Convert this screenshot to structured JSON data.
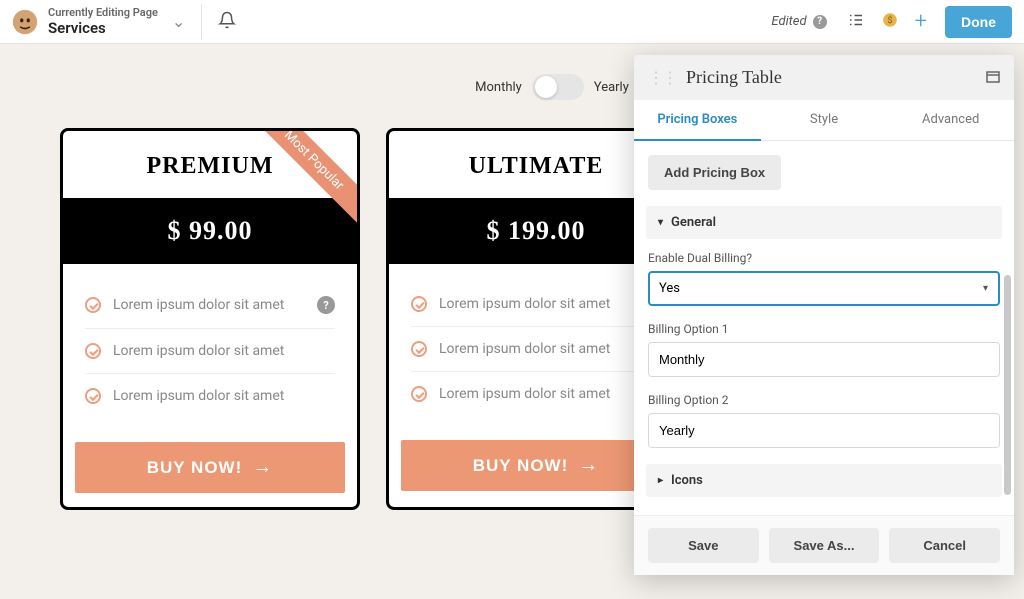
{
  "topbar": {
    "editing_label": "Currently Editing Page",
    "page_name": "Services",
    "edited_label": "Edited",
    "done_label": "Done"
  },
  "billing_toggle": {
    "opt1": "Monthly",
    "opt2": "Yearly"
  },
  "pricing": [
    {
      "tier": "PREMIUM",
      "ribbon": "Most Popular",
      "price": "$ 99.00",
      "features": [
        "Lorem ipsum dolor sit amet",
        "Lorem ipsum dolor sit amet",
        "Lorem ipsum dolor sit amet"
      ],
      "cta": "BUY NOW!"
    },
    {
      "tier": "ULTIMATE",
      "ribbon": "",
      "price": "$ 199.00",
      "features": [
        "Lorem ipsum dolor sit amet",
        "Lorem ipsum dolor sit amet",
        "Lorem ipsum dolor sit amet"
      ],
      "cta": "BUY NOW!"
    }
  ],
  "panel": {
    "title": "Pricing Table",
    "tabs": [
      "Pricing Boxes",
      "Style",
      "Advanced"
    ],
    "add_box": "Add Pricing Box",
    "sections": {
      "general": "General",
      "icons": "Icons"
    },
    "fields": {
      "enable_dual_label": "Enable Dual Billing?",
      "enable_dual_value": "Yes",
      "billing1_label": "Billing Option 1",
      "billing1_value": "Monthly",
      "billing2_label": "Billing Option 2",
      "billing2_value": "Yearly"
    },
    "footer": {
      "save": "Save",
      "save_as": "Save As...",
      "cancel": "Cancel"
    }
  }
}
